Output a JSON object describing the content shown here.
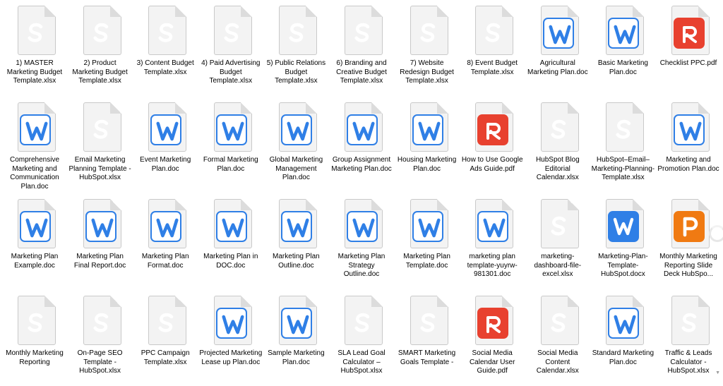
{
  "files": [
    {
      "name": "1) MASTER Marketing Budget Template.xlsx",
      "type": "xlsx",
      "icon": "spreadsheet-icon"
    },
    {
      "name": "2) Product Marketing Budget Template.xlsx",
      "type": "xlsx",
      "icon": "spreadsheet-icon"
    },
    {
      "name": "3) Content Budget Template.xlsx",
      "type": "xlsx",
      "icon": "spreadsheet-icon"
    },
    {
      "name": "4) Paid Advertising Budget Template.xlsx",
      "type": "xlsx",
      "icon": "spreadsheet-icon"
    },
    {
      "name": "5) Public Relations Budget Template.xlsx",
      "type": "xlsx",
      "icon": "spreadsheet-icon"
    },
    {
      "name": "6) Branding and Creative Budget Template.xlsx",
      "type": "xlsx",
      "icon": "spreadsheet-icon"
    },
    {
      "name": "7) Website Redesign Budget Template.xlsx",
      "type": "xlsx",
      "icon": "spreadsheet-icon"
    },
    {
      "name": "8) Event Budget Template.xlsx",
      "type": "xlsx",
      "icon": "spreadsheet-icon"
    },
    {
      "name": "Agricultural Marketing Plan.doc",
      "type": "doc",
      "icon": "document-icon"
    },
    {
      "name": "Basic Marketing Plan.doc",
      "type": "doc",
      "icon": "document-icon"
    },
    {
      "name": "Checklist PPC.pdf",
      "type": "pdf",
      "icon": "pdf-icon"
    },
    {
      "name": "Comprehensive Marketing and Communication Plan.doc",
      "type": "doc",
      "icon": "document-icon"
    },
    {
      "name": "Email Marketing Planning Template - HubSpot.xlsx",
      "type": "xlsx",
      "icon": "spreadsheet-icon"
    },
    {
      "name": "Event Marketing Plan.doc",
      "type": "doc",
      "icon": "document-icon"
    },
    {
      "name": "Formal Marketing Plan.doc",
      "type": "doc",
      "icon": "document-icon"
    },
    {
      "name": "Global Marketing Management Plan.doc",
      "type": "doc",
      "icon": "document-icon"
    },
    {
      "name": "Group Assignment Marketing Plan.doc",
      "type": "doc",
      "icon": "document-icon"
    },
    {
      "name": "Housing Marketing Plan.doc",
      "type": "doc",
      "icon": "document-icon"
    },
    {
      "name": "How to Use Google Ads Guide.pdf",
      "type": "pdf",
      "icon": "pdf-icon"
    },
    {
      "name": "HubSpot Blog Editorial Calendar.xlsx",
      "type": "xlsx",
      "icon": "spreadsheet-icon"
    },
    {
      "name": "HubSpot–Email–Marketing-Planning-Template.xlsx",
      "type": "xlsx",
      "icon": "spreadsheet-icon"
    },
    {
      "name": "Marketing and Promotion Plan.doc",
      "type": "doc",
      "icon": "document-icon"
    },
    {
      "name": "Marketing Plan Example.doc",
      "type": "doc",
      "icon": "document-icon"
    },
    {
      "name": "Marketing Plan Final Report.doc",
      "type": "doc",
      "icon": "document-icon"
    },
    {
      "name": "Marketing Plan Format.doc",
      "type": "doc",
      "icon": "document-icon"
    },
    {
      "name": "Marketing Plan in DOC.doc",
      "type": "doc",
      "icon": "document-icon"
    },
    {
      "name": "Marketing Plan Outline.doc",
      "type": "doc",
      "icon": "document-icon"
    },
    {
      "name": "Marketing Plan Strategy Outline.doc",
      "type": "doc",
      "icon": "document-icon"
    },
    {
      "name": "Marketing Plan Template.doc",
      "type": "doc",
      "icon": "document-icon"
    },
    {
      "name": "marketing plan template-yuyrw-981301.doc",
      "type": "doc",
      "icon": "document-icon"
    },
    {
      "name": "marketing-dashboard-file-excel.xlsx",
      "type": "xlsx",
      "icon": "spreadsheet-icon"
    },
    {
      "name": "Marketing-Plan-Template-HubSpot.docx",
      "type": "docx",
      "icon": "document-icon"
    },
    {
      "name": "Monthly Marketing Reporting Slide Deck HubSpo...",
      "type": "ppt",
      "icon": "presentation-icon"
    },
    {
      "name": "Monthly Marketing Reporting",
      "type": "xlsx",
      "icon": "spreadsheet-icon"
    },
    {
      "name": "On-Page SEO Template - HubSpot.xlsx",
      "type": "xlsx",
      "icon": "spreadsheet-icon"
    },
    {
      "name": "PPC Campaign Template.xlsx",
      "type": "xlsx",
      "icon": "spreadsheet-icon"
    },
    {
      "name": "Projected Marketing Lease up Plan.doc",
      "type": "doc",
      "icon": "document-icon"
    },
    {
      "name": "Sample Marketing Plan.doc",
      "type": "doc",
      "icon": "document-icon"
    },
    {
      "name": "SLA Lead Goal Calculator – HubSpot.xlsx",
      "type": "xlsx",
      "icon": "spreadsheet-icon"
    },
    {
      "name": "SMART Marketing Goals Template -",
      "type": "xlsx",
      "icon": "spreadsheet-icon"
    },
    {
      "name": "Social Media Calendar User Guide.pdf",
      "type": "pdf",
      "icon": "pdf-icon"
    },
    {
      "name": "Social Media Content Calendar.xlsx",
      "type": "xlsx",
      "icon": "spreadsheet-icon"
    },
    {
      "name": "Standard Marketing Plan.doc",
      "type": "doc",
      "icon": "document-icon"
    },
    {
      "name": "Traffic & Leads Calculator - HubSpot.xlsx",
      "type": "xlsx",
      "icon": "spreadsheet-icon"
    }
  ],
  "colors": {
    "spreadsheet": "#1ea048",
    "document": "#2f7fe6",
    "pdf": "#e8412f",
    "presentation": "#f07a12"
  }
}
